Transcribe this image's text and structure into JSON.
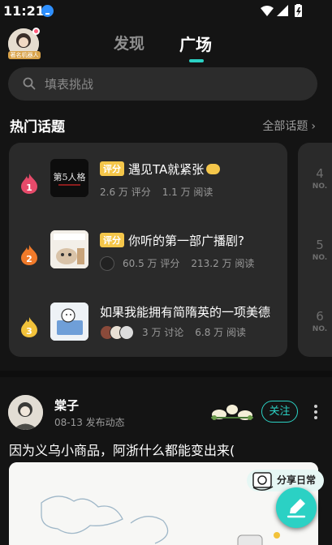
{
  "status_bar": {
    "time": "11:21"
  },
  "header": {
    "avatar_label": "著名机器人",
    "tabs": [
      {
        "label": "发现"
      },
      {
        "label": "广场"
      }
    ]
  },
  "search": {
    "placeholder": "填表挑战"
  },
  "hot_topics": {
    "title": "热门话题",
    "all_label": "全部话题",
    "items": [
      {
        "rank": 1,
        "tag": "评分",
        "title": "遇见TA就紧张",
        "stats": [
          "2.6 万 评分",
          "1.1 万 阅读"
        ],
        "thumb_text": "第5人格",
        "rank_color": "#e64a6a"
      },
      {
        "rank": 2,
        "tag": "评分",
        "title": "你听的第一部广播剧?",
        "stats": [
          "60.5 万 评分",
          "213.2 万 阅读"
        ],
        "thumb_text": "",
        "rank_color": "#f07a2a"
      },
      {
        "rank": 3,
        "tag": "",
        "title": "如果我能拥有简隋英的一项美德",
        "stats": [
          "3 万 讨论",
          "6.8 万 阅读"
        ],
        "thumb_text": "",
        "rank_color": "#f2c23a"
      }
    ],
    "peek_ranks": [
      {
        "num": "4",
        "no": "NO."
      },
      {
        "num": "5",
        "no": "NO."
      },
      {
        "num": "6",
        "no": "NO."
      }
    ]
  },
  "post": {
    "author": "棠子",
    "time": "08-13 发布动态",
    "follow_label": "关注",
    "text": "因为义乌小商品，阿浙什么都能变出来(",
    "share_tag": "分享日常"
  },
  "colors": {
    "accent": "#2bd1c4",
    "tag_yellow": "#f4c64a",
    "background": "#141414",
    "card": "#2a2a2a"
  }
}
